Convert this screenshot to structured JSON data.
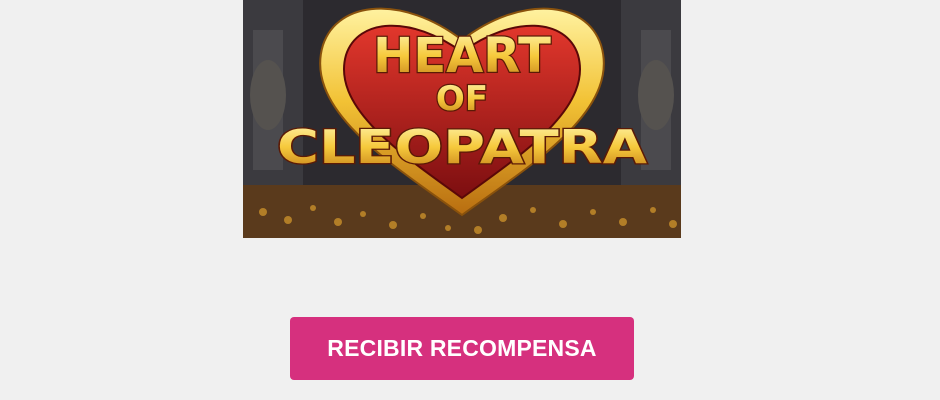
{
  "banner": {
    "title_line1": "HEART",
    "title_line2": "OF",
    "title_line3": "CLEOPATRA",
    "image_alt": "Heart of Cleopatra game banner"
  },
  "cta": {
    "label": "RECIBIR RECOMPENSA",
    "color": "#d6307e"
  }
}
